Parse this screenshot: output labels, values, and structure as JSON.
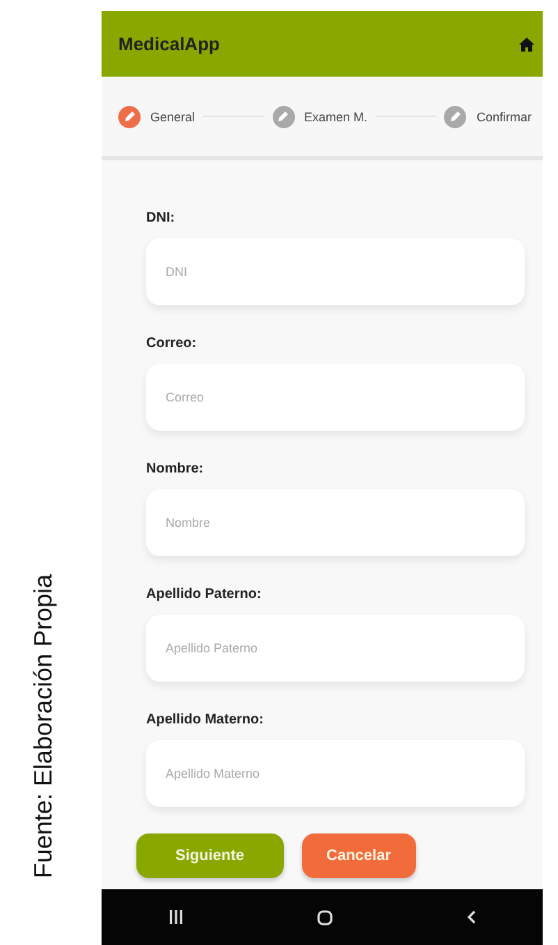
{
  "caption": "Fuente: Elaboración Propia",
  "app_bar": {
    "title": "MedicalApp"
  },
  "steps": [
    {
      "label": "General",
      "selected": true
    },
    {
      "label": "Examen M.",
      "selected": false
    },
    {
      "label": "Confirmar",
      "selected": false
    }
  ],
  "fields": [
    {
      "label": "DNI:",
      "placeholder": "DNI"
    },
    {
      "label": "Correo:",
      "placeholder": "Correo"
    },
    {
      "label": "Nombre:",
      "placeholder": "Nombre"
    },
    {
      "label": "Apellido Paterno:",
      "placeholder": "Apellido Paterno"
    },
    {
      "label": "Apellido Materno:",
      "placeholder": "Apellido Materno"
    }
  ],
  "buttons": [
    {
      "label": "Siguiente",
      "kind": "primary"
    },
    {
      "label": "Cancelar",
      "kind": "cancel"
    }
  ]
}
